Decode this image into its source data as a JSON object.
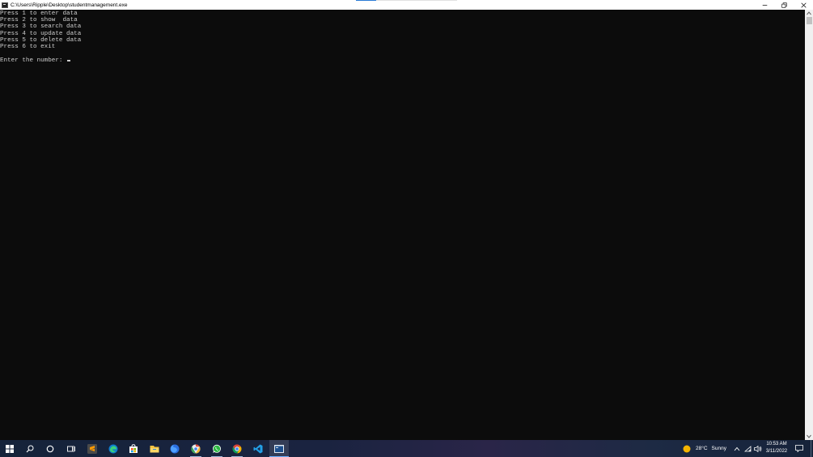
{
  "window": {
    "title": "C:\\Users\\Ripple\\Desktop\\studentmanagement.exe",
    "icon": "console-app-icon",
    "buttons": [
      "minimize",
      "restore",
      "close"
    ]
  },
  "console": {
    "lines": [
      "Press 1 to enter data",
      "Press 2 to show  data",
      "Press 3 to search data",
      "Press 4 to update data",
      "Press 5 to delete data",
      "Press 6 to exit",
      "",
      "Enter the number: "
    ],
    "text_color": "#cccccc",
    "background": "#0c0c0c"
  },
  "taskbar": {
    "icons": [
      "start-icon",
      "search-icon",
      "cortana-icon",
      "task-view-icon",
      "sublime-text-icon",
      "edge-icon",
      "store-icon",
      "file-explorer-icon",
      "firefox-icon",
      "chrome-canary-icon",
      "whatsapp-icon",
      "chrome-icon",
      "vscode-icon",
      "console-app-icon"
    ],
    "weather": {
      "temp": "28°C",
      "condition": "Sunny"
    },
    "clock": {
      "time": "10:53 AM",
      "date": "3/11/2022"
    }
  }
}
